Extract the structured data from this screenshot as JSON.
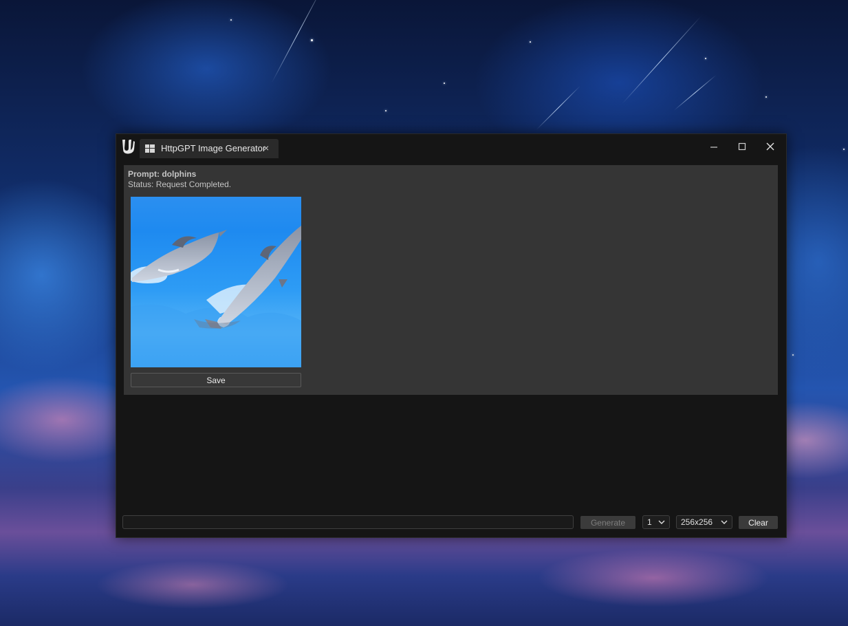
{
  "window": {
    "tab_title": "HttpGPT Image Generator",
    "tab_close_glyph": "×"
  },
  "panel": {
    "prompt_text": "Prompt: dolphins",
    "status_text": "Status: Request Completed.",
    "save_label": "Save"
  },
  "bottom_bar": {
    "prompt_input_value": "",
    "generate_label": "Generate",
    "count_value": "1",
    "size_value": "256x256",
    "clear_label": "Clear"
  },
  "icons": {
    "app_logo": "unreal-engine-logo",
    "tab_icon": "window-grid-icon",
    "minimize": "minimize-icon",
    "maximize": "maximize-icon",
    "close": "close-icon",
    "dropdown": "chevron-down-icon"
  },
  "colors": {
    "window_bg": "#151515",
    "panel_bg": "#353535",
    "tab_bg": "#2a2a2a",
    "button_bg": "#3b3b3b",
    "disabled_text": "#7e7e7e"
  }
}
